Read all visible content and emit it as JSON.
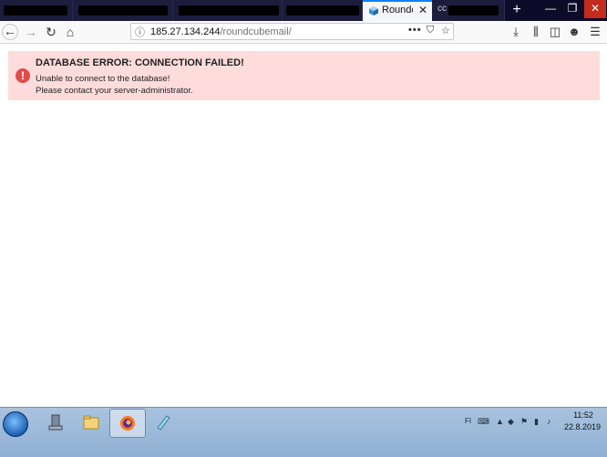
{
  "browser": {
    "active_tab_title": "Roundcube",
    "partial_tab_title": "cc",
    "url_host": "185.27.134.244",
    "url_path": "/roundcubemail/",
    "new_tab_symbol": "+"
  },
  "error": {
    "title": "DATABASE ERROR: CONNECTION FAILED!",
    "line1": "Unable to connect to the database!",
    "line2": "Please contact your server-administrator.",
    "icon_symbol": "!"
  },
  "taskbar": {
    "language": "FI",
    "time": "11:52",
    "date": "22.8.2019"
  },
  "colors": {
    "error_background": "#ffdcdc",
    "error_icon": "#e24b4b",
    "tab_strip": "#0c0c2a",
    "active_tab_accent": "#0a84ff"
  },
  "icons": [
    "back-icon",
    "forward-icon",
    "reload-icon",
    "home-icon",
    "site-info-icon",
    "page-actions-icon",
    "pocket-icon",
    "bookmark-star-icon",
    "downloads-icon",
    "library-icon",
    "sidebar-icon",
    "account-icon",
    "menu-icon",
    "error-icon",
    "start-orb-icon",
    "file-explorer-icon",
    "firefox-icon",
    "notepad-icon"
  ]
}
